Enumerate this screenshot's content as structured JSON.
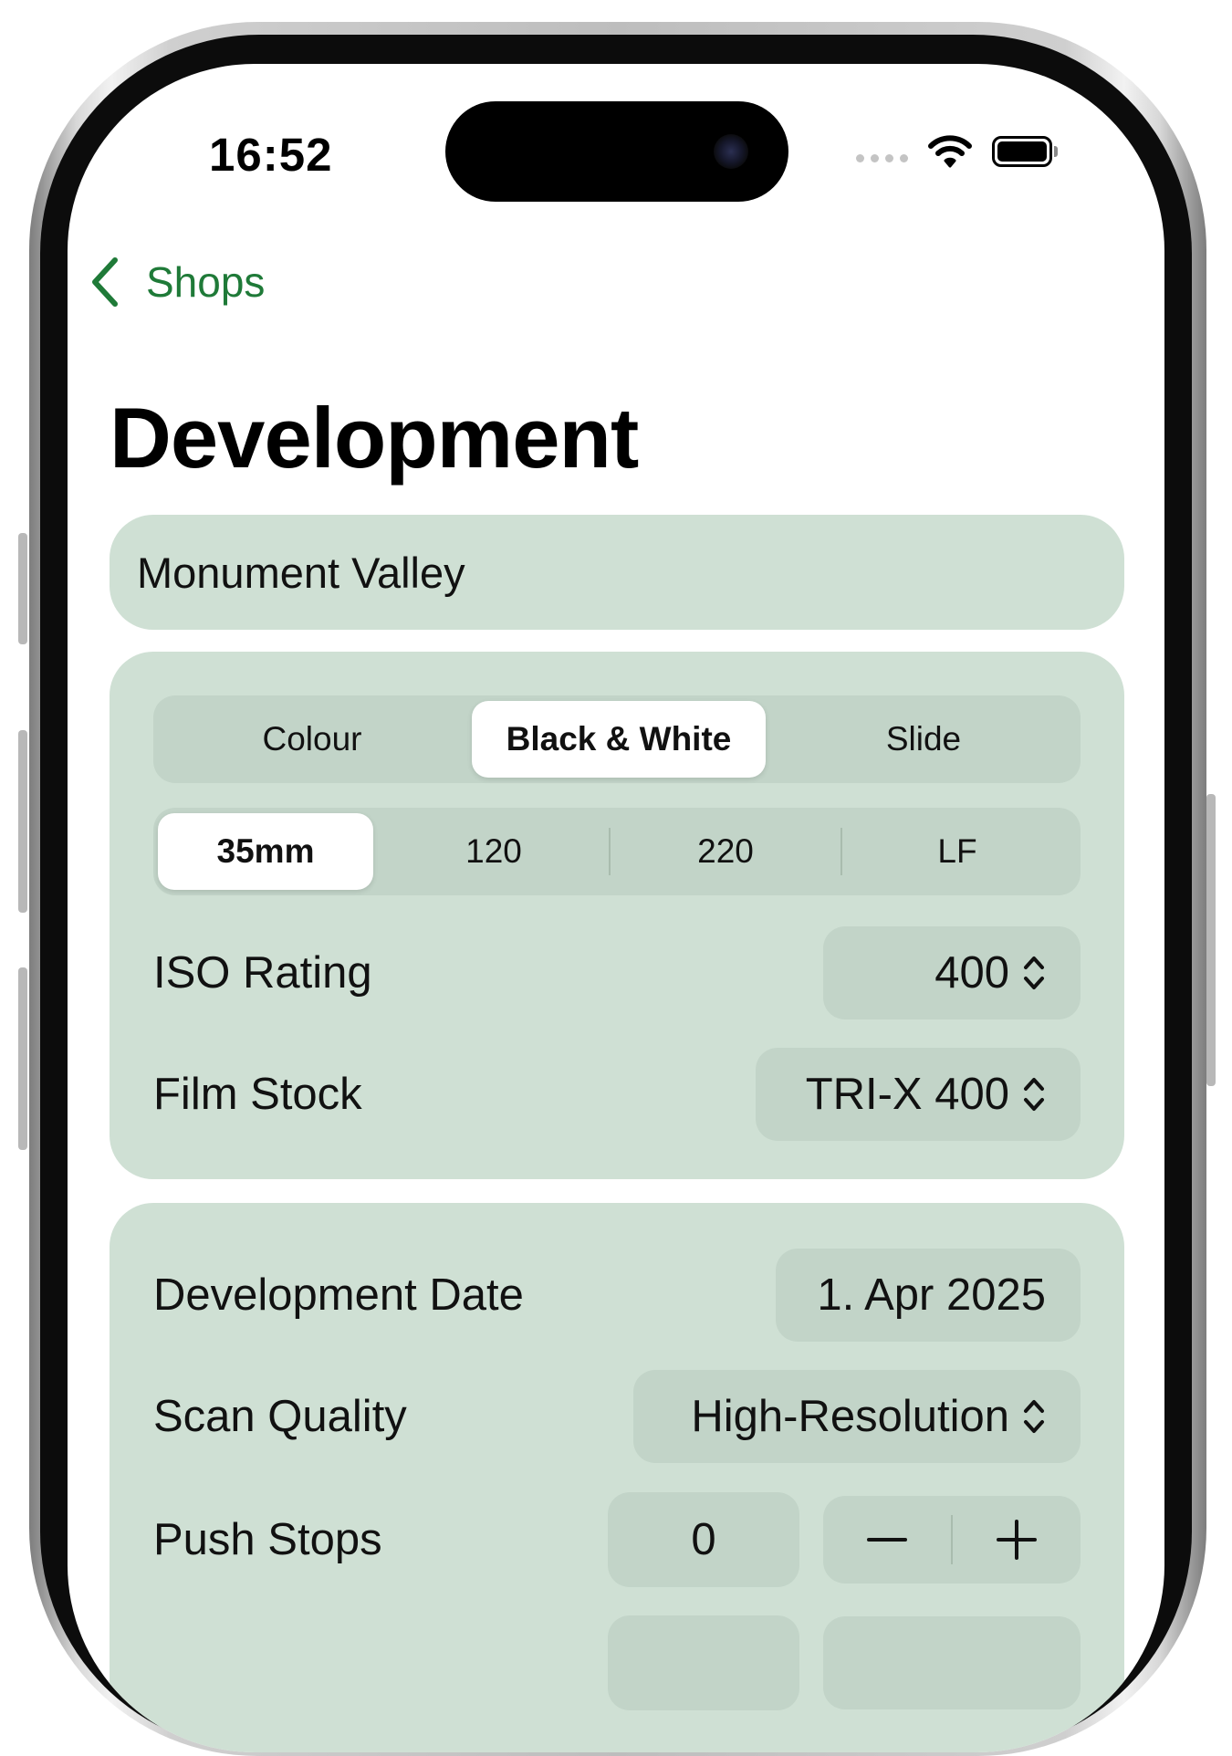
{
  "status_bar": {
    "time": "16:52"
  },
  "nav": {
    "back_label": "Shops"
  },
  "title": "Development",
  "name_field": {
    "value": "Monument Valley"
  },
  "film": {
    "types": [
      "Colour",
      "Black & White",
      "Slide"
    ],
    "selected_type": "Black & White",
    "formats": [
      "35mm",
      "120",
      "220",
      "LF"
    ],
    "selected_format": "35mm",
    "iso_label": "ISO Rating",
    "iso_value": "400",
    "stock_label": "Film Stock",
    "stock_value": "TRI-X 400"
  },
  "development": {
    "date_label": "Development Date",
    "date_value": "1. Apr 2025",
    "scan_label": "Scan Quality",
    "scan_value": "High-Resolution",
    "push_label": "Push Stops",
    "push_value": "0",
    "stepper_minus": "−",
    "stepper_plus": "+"
  },
  "icons": {
    "back": "chevron-left-icon",
    "updown": "chevron-up-down-icon",
    "wifi": "wifi-icon",
    "battery": "battery-icon"
  },
  "colors": {
    "accent": "#1f7a38",
    "card": "#cfe0d4",
    "control": "#c2d4c8"
  }
}
